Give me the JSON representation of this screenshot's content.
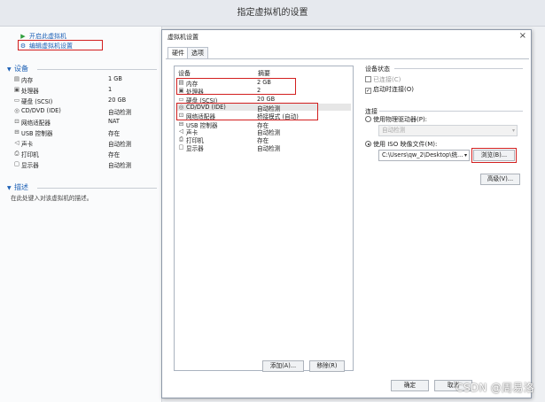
{
  "window": {
    "title": "指定虚拟机的设置"
  },
  "sidebar": {
    "actions": [
      {
        "label": "开启此虚拟机",
        "icon": "play-icon"
      },
      {
        "label": "编辑虚拟机设置",
        "icon": "edit-settings-icon"
      }
    ],
    "devices_heading": "设备",
    "devices": [
      {
        "name": "内存",
        "value": "1 GB",
        "icon": "memory-icon"
      },
      {
        "name": "处理器",
        "value": "1",
        "icon": "cpu-icon"
      },
      {
        "name": "硬盘 (SCSI)",
        "value": "20 GB",
        "icon": "disk-icon"
      },
      {
        "name": "CD/DVD (IDE)",
        "value": "自动检测",
        "icon": "cdrom-icon"
      },
      {
        "name": "网络适配器",
        "value": "NAT",
        "icon": "network-icon"
      },
      {
        "name": "USB 控制器",
        "value": "存在",
        "icon": "usb-icon"
      },
      {
        "name": "声卡",
        "value": "自动检测",
        "icon": "sound-icon"
      },
      {
        "name": "打印机",
        "value": "存在",
        "icon": "printer-icon"
      },
      {
        "name": "显示器",
        "value": "自动检测",
        "icon": "display-icon"
      }
    ],
    "description_heading": "描述",
    "description_placeholder": "在此处键入对该虚拟机的描述。"
  },
  "dialog": {
    "title": "虚拟机设置",
    "close_label": "×",
    "tabs": [
      "硬件",
      "选项"
    ],
    "list_headers": {
      "device": "设备",
      "summary": "摘要"
    },
    "items": [
      {
        "name": "内存",
        "value": "2 GB",
        "icon": "memory-icon"
      },
      {
        "name": "处理器",
        "value": "2",
        "icon": "cpu-icon"
      },
      {
        "name": "硬盘 (SCSI)",
        "value": "20 GB",
        "icon": "disk-icon"
      },
      {
        "name": "CD/DVD (IDE)",
        "value": "自动检测",
        "icon": "cdrom-icon"
      },
      {
        "name": "网络适配器",
        "value": "桥接模式 (自动)",
        "icon": "network-icon"
      },
      {
        "name": "USB 控制器",
        "value": "存在",
        "icon": "usb-icon"
      },
      {
        "name": "声卡",
        "value": "自动检测",
        "icon": "sound-icon"
      },
      {
        "name": "打印机",
        "value": "存在",
        "icon": "printer-icon"
      },
      {
        "name": "显示器",
        "value": "自动检测",
        "icon": "display-icon"
      }
    ],
    "selected_item": "CD/DVD (IDE)",
    "add_button": "添加(A)...",
    "remove_button": "移除(R)",
    "device_status": {
      "title": "设备状态",
      "connected": "已连接(C)",
      "connect_at_power_on": "启动时连接(O)"
    },
    "connection": {
      "title": "连接",
      "physical_drive": "使用物理驱动器(P):",
      "physical_drive_value": "自动检测",
      "iso_image": "使用 ISO 映像文件(M):",
      "iso_path": "C:\\Users\\qw_2\\Desktop\\统...",
      "browse_button": "浏览(B)...",
      "advanced_button": "高级(V)..."
    },
    "ok_button": "确定",
    "cancel_button": "取消"
  },
  "watermark": "CSDN @周易洛"
}
